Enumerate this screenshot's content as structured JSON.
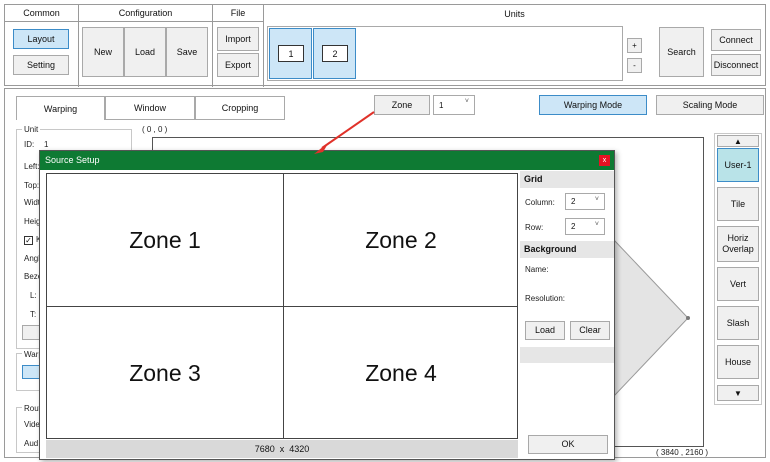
{
  "toolbar": {
    "common": {
      "title": "Common",
      "layout": "Layout",
      "setting": "Setting"
    },
    "configuration": {
      "title": "Configuration",
      "new": "New",
      "load": "Load",
      "save": "Save"
    },
    "file": {
      "title": "File",
      "import": "Import",
      "export": "Export"
    },
    "units": {
      "title": "Units",
      "unit_items": [
        "1",
        "2"
      ],
      "plus": "+",
      "minus": "-",
      "search": "Search",
      "connect": "Connect",
      "disconnect": "Disconnect"
    }
  },
  "tabs": {
    "warping": "Warping",
    "window": "Window",
    "cropping": "Cropping"
  },
  "zone": {
    "label": "Zone",
    "value": "1",
    "chevron": "˅"
  },
  "modes": {
    "warping": "Warping Mode",
    "scaling": "Scaling Mode"
  },
  "left_panel": {
    "unit_title": "Unit",
    "id_label": "ID:",
    "id_value": "1",
    "left": "Left:",
    "top": "Top:",
    "width": "Widt",
    "height": "Heig",
    "keep": "K",
    "angle": "Angl",
    "bezel": "Beze",
    "l": "L:",
    "t": "T:",
    "warp": "Warp",
    "routing": "Routi",
    "video": "Vide",
    "audio": "Aud"
  },
  "canvas": {
    "origin": "( 0 , 0 )",
    "extent": "( 3840 , 2160 )"
  },
  "presets": {
    "up": "▲",
    "items": [
      "User-1",
      "Tile",
      "Horiz\nOverlap",
      "Vert",
      "Slash",
      "House"
    ],
    "down": "▼"
  },
  "dialog": {
    "title": "Source Setup",
    "close": "x",
    "zones": [
      "Zone 1",
      "Zone 2",
      "Zone 3",
      "Zone 4"
    ],
    "resolution_w": "7680",
    "resolution_x": "x",
    "resolution_h": "4320",
    "grid_title": "Grid",
    "column_label": "Column:",
    "column_value": "2",
    "row_label": "Row:",
    "row_value": "2",
    "background_title": "Background",
    "name_label": "Name:",
    "resolution_label": "Resolution:",
    "load": "Load",
    "clear": "Clear",
    "ok": "OK",
    "chevron": "˅"
  },
  "colors": {
    "dialog_header": "#0e7a33",
    "close_button": "#e81123",
    "arrow": "#e0322a",
    "selected_blue": "#cde6f7",
    "preset_selected": "#b9e3e8"
  }
}
